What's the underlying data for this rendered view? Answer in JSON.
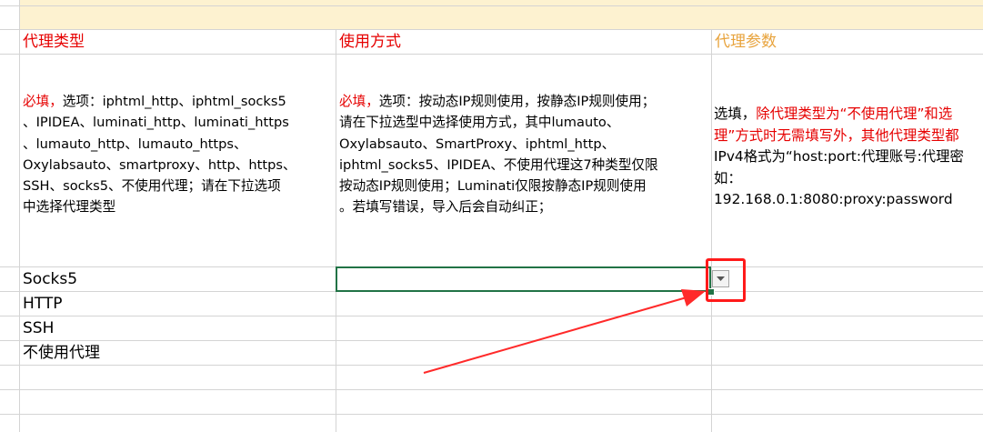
{
  "headers": {
    "proxy_type": "代理类型",
    "usage_mode": "使用方式",
    "proxy_params": "代理参数"
  },
  "descriptions": {
    "proxy_type": {
      "required": "必填，",
      "text": "选项：iphtml_http、iphtml_socks5\n、IPIDEA、luminati_http、luminati_https\n、lumauto_http、lumauto_https、\nOxylabsauto、smartproxy、http、https、\nSSH、socks5、不使用代理；请在下拉选项\n中选择代理类型"
    },
    "usage_mode": {
      "required": "必填，",
      "text": "选项：按动态IP规则使用，按静态IP规则使用；\n请在下拉选型中选择使用方式，其中lumauto、\nOxylabsauto、SmartProxy、iphtml_http、\niphtml_socks5、IPIDEA、不使用代理这7种类型仅限\n按动态IP规则使用；Luminati仅限按静态IP规则使用\n。若填写错误，导入后会自动纠正；"
    },
    "proxy_params": {
      "optional": "选填，",
      "red_line1": "除代理类型为“不使用代理”和选",
      "red_line2": "理”方式时无需填写外，其他代理类型都",
      "line3": "IPv4格式为“host:port:代理账号:代理密",
      "line4": "如：",
      "line5": "192.168.0.1:8080:proxy:password"
    }
  },
  "rows": [
    "Socks5",
    "HTTP",
    "SSH",
    "不使用代理"
  ],
  "colors": {
    "header_red": "#e60000",
    "header_orange": "#e8a33c",
    "selection_green": "#217346",
    "annotation_red": "#ff1a1a",
    "band_yellow": "#fdf2d0"
  },
  "icons": {
    "dropdown": "chevron-down-icon"
  }
}
